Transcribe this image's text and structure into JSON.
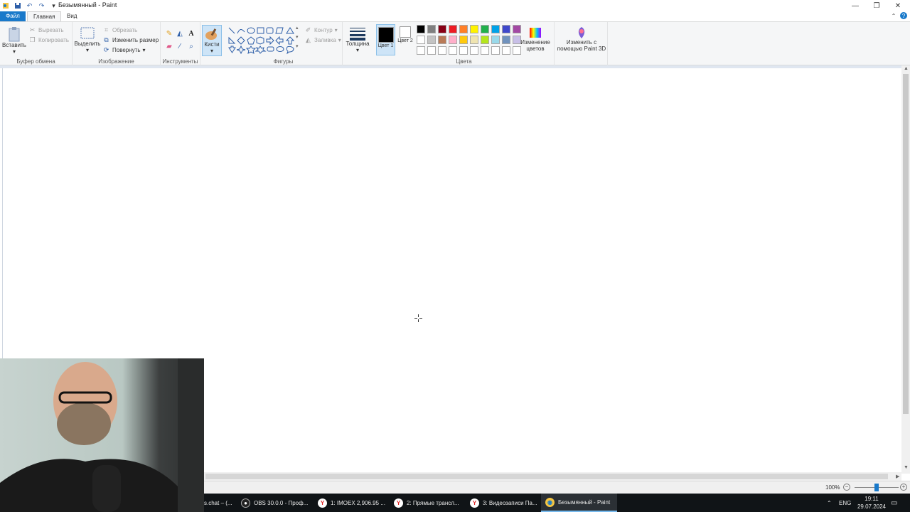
{
  "window": {
    "title": "Безымянный - Paint",
    "controls": {
      "minimize": "—",
      "restore": "❐",
      "close": "✕"
    }
  },
  "quick_access": {
    "dropdown": "▾"
  },
  "tabs": [
    {
      "label": "Файл"
    },
    {
      "label": "Главная"
    },
    {
      "label": "Вид"
    }
  ],
  "ribbon": {
    "clipboard": {
      "group_label": "Буфер обмена",
      "paste": "Вставить",
      "cut": "Вырезать",
      "copy": "Копировать"
    },
    "image": {
      "group_label": "Изображение",
      "select": "Выделить",
      "crop": "Обрезать",
      "resize": "Изменить размер",
      "rotate": "Повернуть"
    },
    "tools": {
      "group_label": "Инструменты"
    },
    "brushes": {
      "label": "Кисти"
    },
    "shapes": {
      "group_label": "Фигуры",
      "outline": "Контур",
      "fill": "Заливка"
    },
    "size": {
      "label": "Толщина"
    },
    "colors": {
      "group_label": "Цвета",
      "color1": "Цвет 1",
      "color2": "Цвет 2",
      "color1_value": "#000000",
      "color2_value": "#ffffff",
      "edit_colors": "Изменение цветов",
      "paint3d": "Изменить с помощью Paint 3D",
      "palette": [
        "#000000",
        "#7f7f7f",
        "#880015",
        "#ed1c24",
        "#ff7f27",
        "#fff200",
        "#22b14c",
        "#00a2e8",
        "#3f48cc",
        "#a349a4",
        "#ffffff",
        "#c3c3c3",
        "#b97a57",
        "#ffaec9",
        "#ffc90e",
        "#efe4b0",
        "#b5e61d",
        "#99d9ea",
        "#7092be",
        "#c8bfe7",
        "#ffffff",
        "#ffffff",
        "#ffffff",
        "#ffffff",
        "#ffffff",
        "#ffffff",
        "#ffffff",
        "#ffffff",
        "#ffffff",
        "#ffffff"
      ]
    }
  },
  "status": {
    "zoom": "100%",
    "zoom_out": "−",
    "zoom_in": "+",
    "zoom_fraction": 0.5
  },
  "taskbar": {
    "items": [
      {
        "label": "s.chat – (...",
        "icon": "chat-icon"
      },
      {
        "label": "OBS 30.0.0 - Проф...",
        "icon": "obs-icon"
      },
      {
        "label": "1: IMOEX 2,906.95 ...",
        "icon": "yandex-browser-icon"
      },
      {
        "label": "2: Прямые трансл...",
        "icon": "yandex-browser-icon"
      },
      {
        "label": "3: Видеозаписи Па...",
        "icon": "yandex-browser-icon"
      },
      {
        "label": "Безымянный - Paint",
        "icon": "paint-icon"
      }
    ],
    "lang": "ENG",
    "time": "19:11",
    "date": "29.07.2024"
  }
}
